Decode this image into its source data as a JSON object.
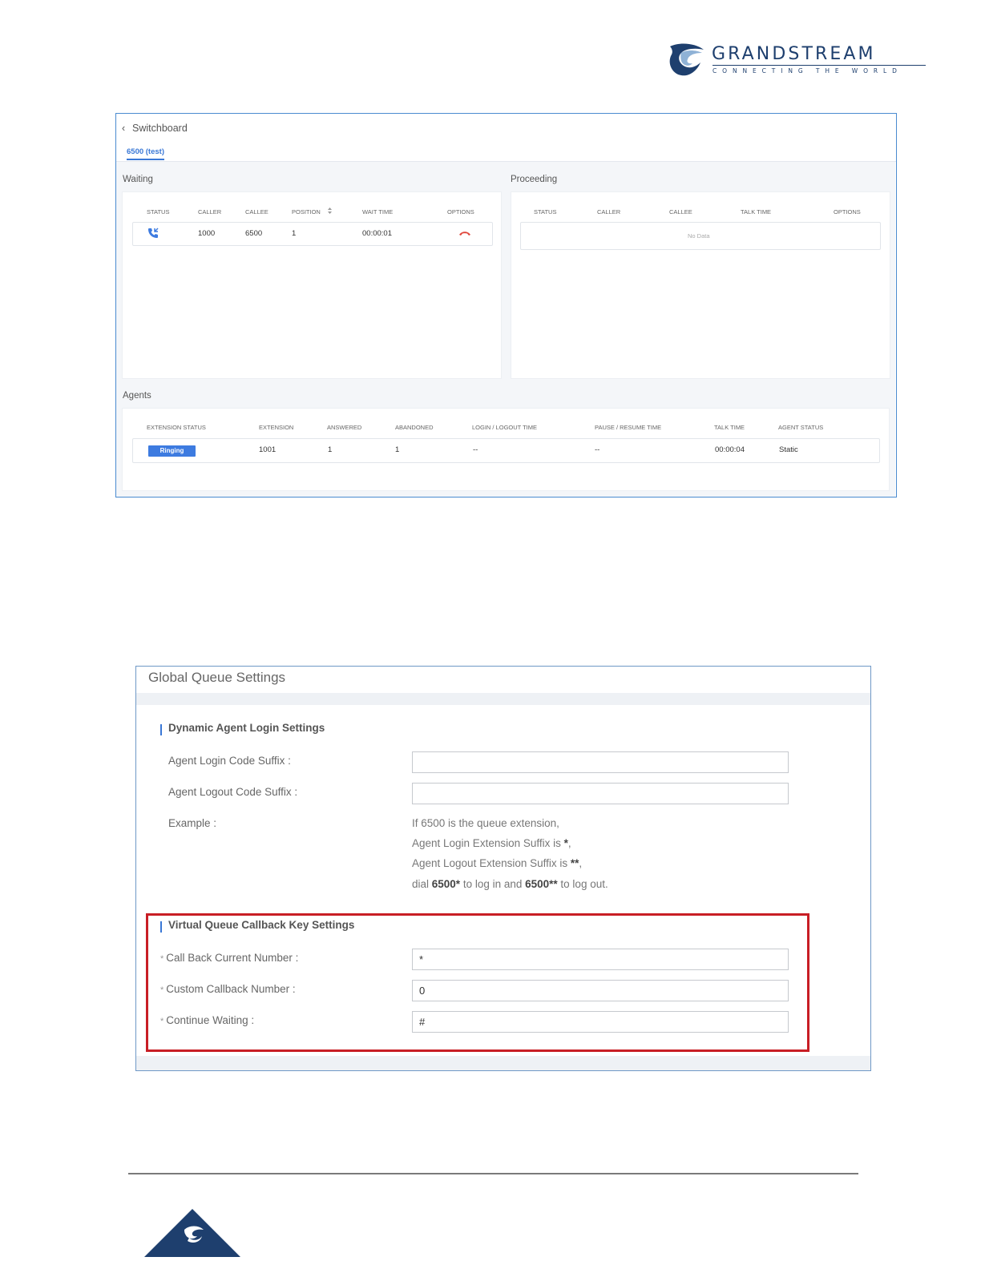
{
  "logo": {
    "name": "GRANDSTREAM",
    "tagline": "CONNECTING THE WORLD",
    "icon": "grandstream-swirl-icon"
  },
  "switchboard": {
    "back_icon": "chevron-left-icon",
    "title": "Switchboard",
    "tab": "6500 (test)",
    "waiting": {
      "label": "Waiting",
      "headers": [
        "STATUS",
        "CALLER",
        "CALLEE",
        "POSITION",
        "WAIT TIME",
        "OPTIONS"
      ],
      "sort_icon": "sort-icon",
      "rows": [
        {
          "status_icon": "incoming-call-icon",
          "caller": "1000",
          "callee": "6500",
          "position": "1",
          "wait_time": "00:00:01",
          "option_icon": "hang-up-icon"
        }
      ]
    },
    "proceeding": {
      "label": "Proceeding",
      "headers": [
        "STATUS",
        "CALLER",
        "CALLEE",
        "TALK TIME",
        "OPTIONS"
      ],
      "empty_text": "No Data"
    },
    "agents": {
      "label": "Agents",
      "headers": [
        "EXTENSION STATUS",
        "EXTENSION",
        "ANSWERED",
        "ABANDONED",
        "LOGIN / LOGOUT TIME",
        "PAUSE / RESUME TIME",
        "TALK TIME",
        "AGENT STATUS"
      ],
      "rows": [
        {
          "extension_status": "Ringing",
          "extension": "1001",
          "answered": "1",
          "abandoned": "1",
          "login_logout": "--",
          "pause_resume": "--",
          "talk_time": "00:00:04",
          "agent_status": "Static"
        }
      ]
    },
    "colors": {
      "accent": "#3a78d6",
      "hangup": "#e0463b",
      "badge": "#3d7be0"
    }
  },
  "global_queue": {
    "title": "Global Queue Settings",
    "dynamic": {
      "heading": "Dynamic Agent Login Settings",
      "login_label": "Agent Login Code Suffix :",
      "login_value": "",
      "logout_label": "Agent Logout Code Suffix :",
      "logout_value": "",
      "example_label": "Example :",
      "example_line1": "If 6500 is the queue extension,",
      "example_line2_a": "Agent Login Extension Suffix is ",
      "example_line2_b": "*",
      "example_line2_c": ",",
      "example_line3_a": "Agent Logout Extension Suffix is ",
      "example_line3_b": "**",
      "example_line3_c": ",",
      "example_line4_a": "dial ",
      "example_line4_b": "6500*",
      "example_line4_c": " to log in and ",
      "example_line4_d": "6500**",
      "example_line4_e": " to log out."
    },
    "callback": {
      "heading": "Virtual Queue Callback Key Settings",
      "required_mark": "*",
      "current_label": "Call Back Current Number :",
      "current_value": "*",
      "custom_label": "Custom Callback Number :",
      "custom_value": "0",
      "continue_label": "Continue Waiting :",
      "continue_value": "#"
    },
    "colors": {
      "highlight_border": "#c81e25",
      "section_bar": "#3a78d6"
    }
  },
  "footer": {
    "icon": "grandstream-triangle-icon"
  }
}
